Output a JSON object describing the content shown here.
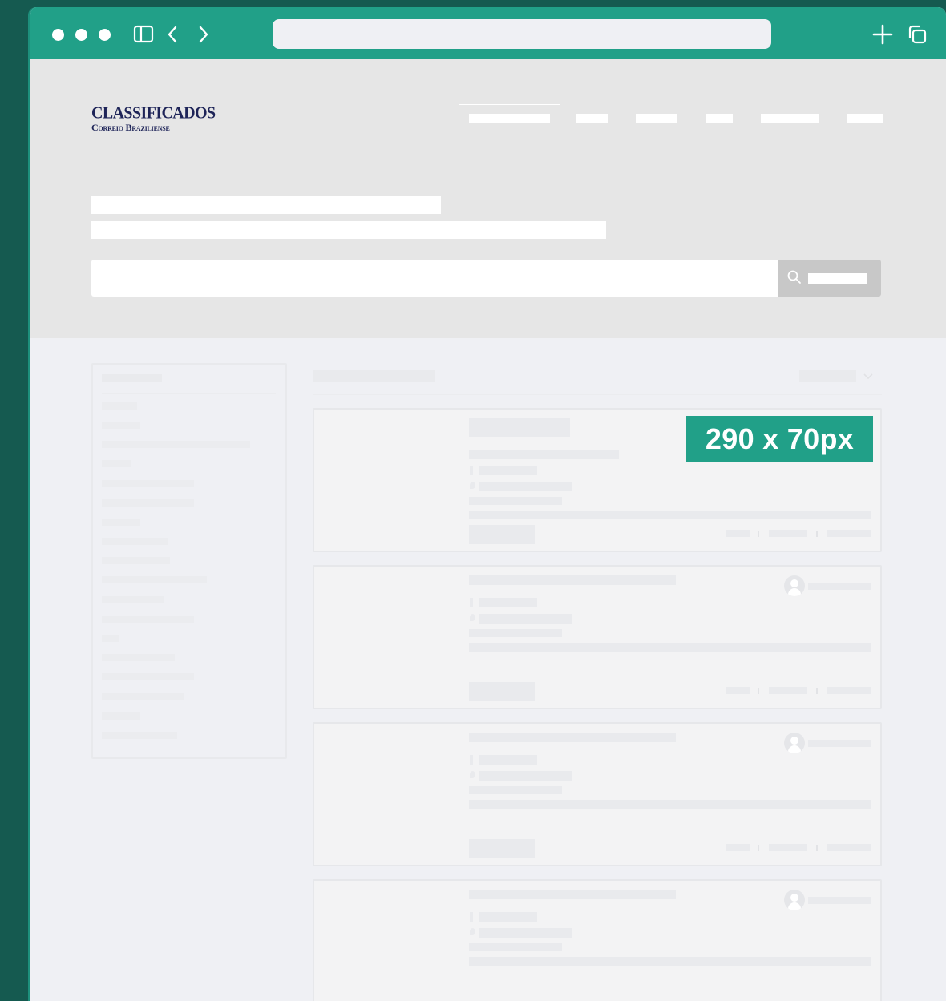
{
  "theme": {
    "outer_bg": "#155a50",
    "accent": "#21a088",
    "logo_color": "#1e2458",
    "hero_bg": "#e6e6e6",
    "page_bg": "#eff0f4"
  },
  "browser": {
    "icons": [
      "window-dot-icon",
      "sidebar-toggle-icon",
      "back-arrow-icon",
      "forward-arrow-icon",
      "new-tab-plus-icon",
      "duplicate-tabs-icon"
    ],
    "url": ""
  },
  "header": {
    "logo_line1": "CLASSIFICADOS",
    "logo_line2": "Correio Braziliense"
  },
  "search": {
    "placeholder": "",
    "icon": "search-icon"
  },
  "listing": {
    "ad_label": "290 x 70px"
  }
}
